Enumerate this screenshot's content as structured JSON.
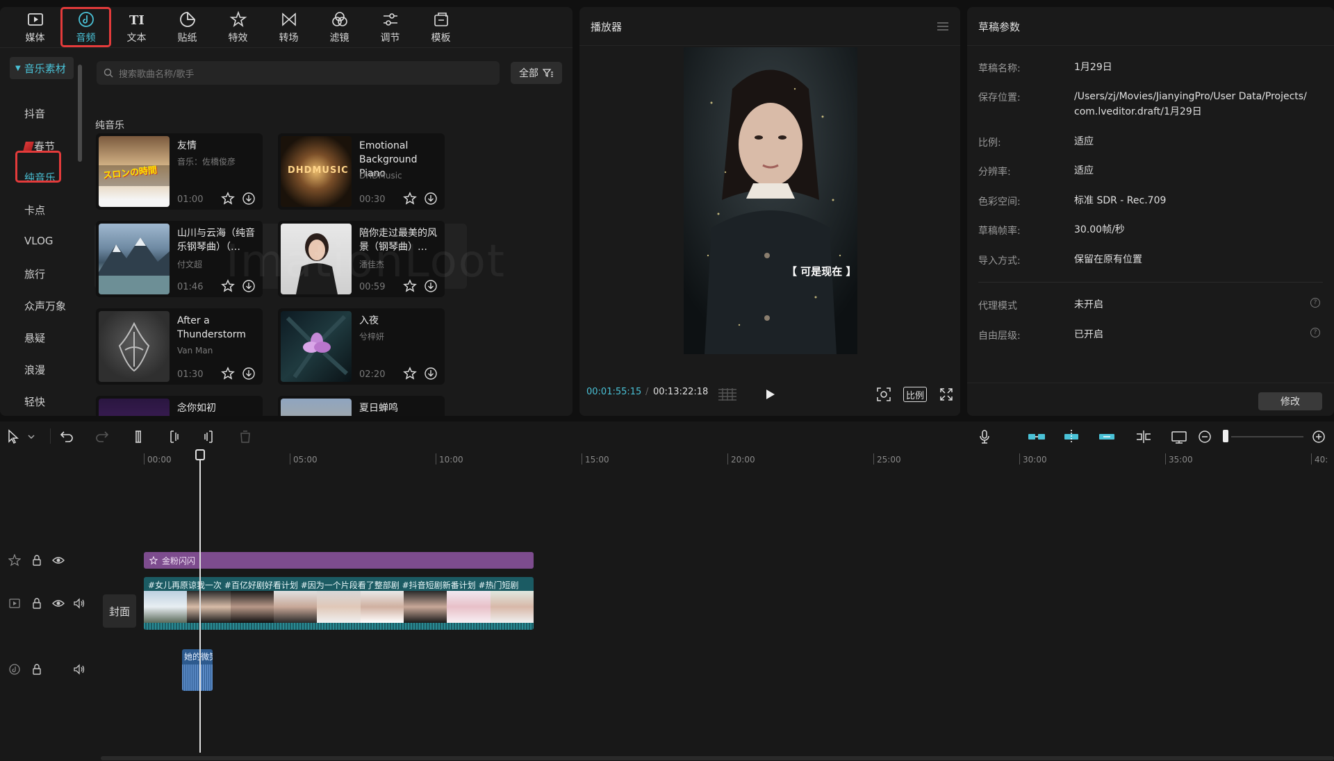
{
  "toolbar": {
    "tabs": [
      {
        "label": "媒体",
        "icon": "media-icon"
      },
      {
        "label": "音频",
        "icon": "audio-icon"
      },
      {
        "label": "文本",
        "icon": "text-icon"
      },
      {
        "label": "贴纸",
        "icon": "sticker-icon"
      },
      {
        "label": "特效",
        "icon": "effects-icon"
      },
      {
        "label": "转场",
        "icon": "transition-icon"
      },
      {
        "label": "滤镜",
        "icon": "filter-icon"
      },
      {
        "label": "调节",
        "icon": "adjust-icon"
      },
      {
        "label": "模板",
        "icon": "template-icon"
      }
    ],
    "active_tab": "音频"
  },
  "sidebar": {
    "header": "音乐素材",
    "items": [
      {
        "label": "抖音"
      },
      {
        "label": "春节"
      },
      {
        "label": "纯音乐"
      },
      {
        "label": "卡点"
      },
      {
        "label": "VLOG"
      },
      {
        "label": "旅行"
      },
      {
        "label": "众声万象"
      },
      {
        "label": "悬疑"
      },
      {
        "label": "浪漫"
      },
      {
        "label": "轻快"
      }
    ],
    "active_item": "纯音乐"
  },
  "search": {
    "placeholder": "搜索歌曲名称/歌手"
  },
  "filter": {
    "label": "全部"
  },
  "section": {
    "title": "纯音乐"
  },
  "tracks": [
    {
      "title": "友情",
      "artist": "音乐：佐橋俊彦",
      "duration": "01:00"
    },
    {
      "title": "Emotional Background Piano",
      "artist": "DHDMusic",
      "duration": "00:30"
    },
    {
      "title": "山川与云海（纯音乐钢琴曲）（…",
      "artist": "付文超",
      "duration": "01:46"
    },
    {
      "title": "陪你走过最美的风景（钢琴曲）…",
      "artist": "潘佳杰",
      "duration": "00:59"
    },
    {
      "title": "After a Thunderstorm",
      "artist": "Van Man",
      "duration": "01:30"
    },
    {
      "title": "入夜",
      "artist": "兮梓妍",
      "duration": "02:20"
    },
    {
      "title": "念你如初",
      "artist": "",
      "duration": ""
    },
    {
      "title": "夏日蝉鸣",
      "artist": "",
      "duration": ""
    }
  ],
  "thumb_texts": {
    "t1": "スロンの時間",
    "t2": "DHDMUSIC"
  },
  "watermark": "ImationLoot",
  "player": {
    "title": "播放器",
    "subtitle": "【 可是现在 】",
    "current_time": "00:01:55:15",
    "total_time": "00:13:22:18",
    "separator": "/",
    "ratio_label": "比例"
  },
  "draft": {
    "title": "草稿参数",
    "fields": [
      {
        "label": "草稿名称:",
        "value": "1月29日"
      },
      {
        "label": "保存位置:",
        "value": "/Users/zj/Movies/JianyingPro/User Data/Projects/com.lveditor.draft/1月29日"
      },
      {
        "label": "比例:",
        "value": "适应"
      },
      {
        "label": "分辨率:",
        "value": "适应"
      },
      {
        "label": "色彩空间:",
        "value": "标准 SDR - Rec.709"
      },
      {
        "label": "草稿帧率:",
        "value": "30.00帧/秒"
      },
      {
        "label": "导入方式:",
        "value": "保留在原有位置"
      },
      {
        "label": "代理模式",
        "value": "未开启"
      },
      {
        "label": "自由层级:",
        "value": "已开启"
      }
    ],
    "help_glyph": "?",
    "modify_label": "修改"
  },
  "timeline": {
    "ruler": [
      "00:00",
      "05:00",
      "10:00",
      "15:00",
      "20:00",
      "25:00",
      "30:00",
      "35:00",
      "40:"
    ],
    "cover_label": "封面",
    "effect_clip": "金粉闪闪",
    "video_clip_text": "#女儿再原谅我一次 #百亿好剧好看计划 #因为一个片段看了整部剧 #抖音短剧新番计划 #热门短剧",
    "audio_clip": "她的微笑"
  },
  "colors": {
    "accent": "#4ac2d7",
    "highlight_box": "#e43b3b",
    "effect_clip": "#7d4c8e",
    "video_clip": "#1b5b63",
    "audio_clip": "#2d5a8e"
  }
}
